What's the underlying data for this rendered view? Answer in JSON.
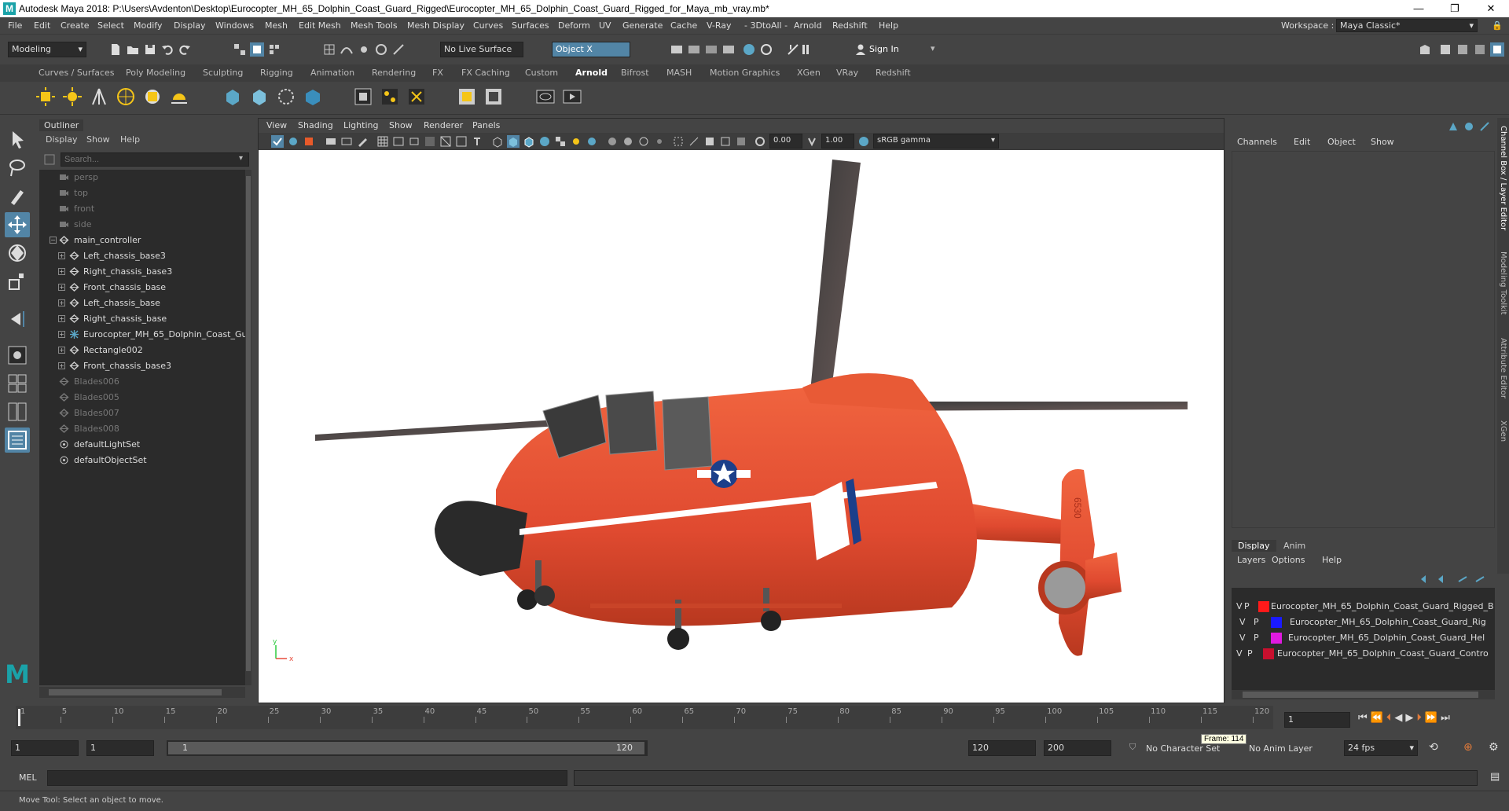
{
  "window": {
    "title": "Autodesk Maya 2018: P:\\Users\\Avdenton\\Desktop\\Eurocopter_MH_65_Dolphin_Coast_Guard_Rigged\\Eurocopter_MH_65_Dolphin_Coast_Guard_Rigged_for_Maya_mb_vray.mb*",
    "minimize": "—",
    "maximize": "❐",
    "close": "✕"
  },
  "menubar": [
    "File",
    "Edit",
    "Create",
    "Select",
    "Modify",
    "Display",
    "Windows",
    "Mesh",
    "Edit Mesh",
    "Mesh Tools",
    "Mesh Display",
    "Curves",
    "Surfaces",
    "Deform",
    "UV",
    "Generate",
    "Cache",
    "V-Ray",
    "- 3DtoAll -",
    "Arnold",
    "Redshift",
    "Help"
  ],
  "workspace": {
    "label": "Workspace :",
    "value": "Maya Classic*"
  },
  "statusline": {
    "mode": "Modeling",
    "live_surface": "No Live Surface",
    "symmetry": "Object X",
    "sign_in": "Sign In"
  },
  "shelf_tabs": [
    "Curves / Surfaces",
    "Poly Modeling",
    "Sculpting",
    "Rigging",
    "Animation",
    "Rendering",
    "FX",
    "FX Caching",
    "Custom",
    "Arnold",
    "Bifrost",
    "MASH",
    "Motion Graphics",
    "XGen",
    "VRay",
    "Redshift"
  ],
  "shelf_active": "Arnold",
  "outliner": {
    "tab": "Outliner",
    "menu": [
      "Display",
      "Show",
      "Help"
    ],
    "search_placeholder": "Search...",
    "items": [
      {
        "label": "persp",
        "type": "camera",
        "dim": true,
        "indent": 0
      },
      {
        "label": "top",
        "type": "camera",
        "dim": true,
        "indent": 0
      },
      {
        "label": "front",
        "type": "camera",
        "dim": true,
        "indent": 0
      },
      {
        "label": "side",
        "type": "camera",
        "dim": true,
        "indent": 0
      },
      {
        "label": "main_controller",
        "type": "transform",
        "dim": false,
        "indent": 0,
        "expander": "minus"
      },
      {
        "label": "Left_chassis_base3",
        "type": "transform",
        "dim": false,
        "indent": 1,
        "expander": "plus"
      },
      {
        "label": "Right_chassis_base3",
        "type": "transform",
        "dim": false,
        "indent": 1,
        "expander": "plus"
      },
      {
        "label": "Front_chassis_base",
        "type": "transform",
        "dim": false,
        "indent": 1,
        "expander": "plus"
      },
      {
        "label": "Left_chassis_base",
        "type": "transform",
        "dim": false,
        "indent": 1,
        "expander": "plus"
      },
      {
        "label": "Right_chassis_base",
        "type": "transform",
        "dim": false,
        "indent": 1,
        "expander": "plus"
      },
      {
        "label": "Eurocopter_MH_65_Dolphin_Coast_Gu",
        "type": "joint",
        "dim": false,
        "indent": 1,
        "expander": "plus"
      },
      {
        "label": "Rectangle002",
        "type": "transform",
        "dim": false,
        "indent": 1,
        "expander": "plus"
      },
      {
        "label": "Front_chassis_base3",
        "type": "transform",
        "dim": false,
        "indent": 1,
        "expander": "plus"
      },
      {
        "label": "Blades006",
        "type": "transform",
        "dim": true,
        "indent": 0
      },
      {
        "label": "Blades005",
        "type": "transform",
        "dim": true,
        "indent": 0
      },
      {
        "label": "Blades007",
        "type": "transform",
        "dim": true,
        "indent": 0
      },
      {
        "label": "Blades008",
        "type": "transform",
        "dim": true,
        "indent": 0
      },
      {
        "label": "defaultLightSet",
        "type": "set",
        "dim": false,
        "indent": 0
      },
      {
        "label": "defaultObjectSet",
        "type": "set",
        "dim": false,
        "indent": 0
      }
    ]
  },
  "viewport": {
    "menu": [
      "View",
      "Shading",
      "Lighting",
      "Show",
      "Renderer",
      "Panels"
    ],
    "exposure": "0.00",
    "gamma": "1.00",
    "color_space": "sRGB gamma",
    "axis_x": "x",
    "axis_y": "y"
  },
  "channel_box": {
    "menu": [
      "Channels",
      "Edit",
      "Object",
      "Show"
    ],
    "layer_tabs": [
      "Display",
      "Anim"
    ],
    "layer_menu": [
      "Layers",
      "Options",
      "Help"
    ],
    "layers": [
      {
        "v": "V",
        "p": "P",
        "color": "#ff1a1a",
        "name": "Eurocopter_MH_65_Dolphin_Coast_Guard_Rigged_B"
      },
      {
        "v": "V",
        "p": "P",
        "color": "#1a1aff",
        "name": "Eurocopter_MH_65_Dolphin_Coast_Guard_Rig"
      },
      {
        "v": "V",
        "p": "P",
        "color": "#e01ae0",
        "name": "Eurocopter_MH_65_Dolphin_Coast_Guard_Hel"
      },
      {
        "v": "V",
        "p": "P",
        "color": "#c8102e",
        "name": "Eurocopter_MH_65_Dolphin_Coast_Guard_Contro"
      }
    ]
  },
  "side_tabs": [
    "Channel Box / Layer Editor",
    "Modeling Toolkit",
    "Attribute Editor",
    "XGen"
  ],
  "timeslider": {
    "ticks": [
      "1",
      "5",
      "10",
      "15",
      "20",
      "25",
      "30",
      "35",
      "40",
      "45",
      "50",
      "55",
      "60",
      "65",
      "70",
      "75",
      "80",
      "85",
      "90",
      "95",
      "100",
      "105",
      "110",
      "115",
      "120"
    ],
    "current_frame": "1"
  },
  "range": {
    "start": "1",
    "playback_start": "1",
    "slider_start": "1",
    "slider_end": "120",
    "playback_end": "120",
    "end": "200",
    "character": "No Character Set",
    "anim_layer": "No Anim Layer",
    "fps": "24 fps",
    "tooltip": "Frame: 114"
  },
  "command_line": {
    "label": "MEL"
  },
  "help_line": "Move Tool: Select an object to move.",
  "helicopter": {
    "tail_number": "6530",
    "colors": {
      "body": "#e8553a",
      "nose": "#2a2a2a",
      "blade": "#4a4a4a"
    }
  }
}
